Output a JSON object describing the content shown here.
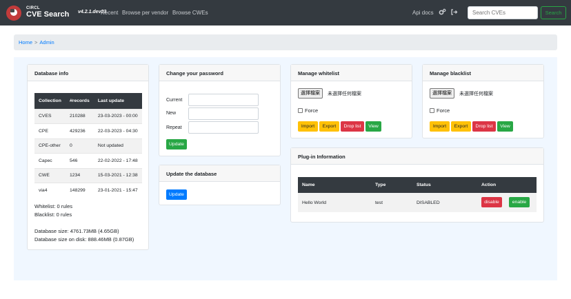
{
  "navbar": {
    "brand_small": "CIRCL",
    "brand_name": "CVE Search",
    "version": "v4.2.1.dev23",
    "links": [
      "Recent",
      "Browse per vendor",
      "Browse CWEs"
    ],
    "api_docs": "Api docs",
    "search_placeholder": "Search CVEs",
    "search_button": "Search"
  },
  "breadcrumb": {
    "home": "Home",
    "separator": ">",
    "current": "Admin"
  },
  "database_info": {
    "title": "Database info",
    "columns": [
      "Collection",
      "#records",
      "Last update"
    ],
    "rows": [
      [
        "CVES",
        "210288",
        "23-03-2023 - 00:00"
      ],
      [
        "CPE",
        "429236",
        "22-03-2023 - 04:30"
      ],
      [
        "CPE-other",
        "0",
        "Not updated"
      ],
      [
        "Capec",
        "546",
        "22-02-2022 - 17:48"
      ],
      [
        "CWE",
        "1234",
        "15-03-2021 - 12:38"
      ],
      [
        "via4",
        "148299",
        "23-01-2021 - 15:47"
      ]
    ],
    "whitelist": "Whitelist: 0 rules",
    "blacklist": "Blacklist: 0 rules",
    "db_size": "Database size: 4761.73MB (4.65GB)",
    "db_size_disk": "Database size on disk: 888.46MB (0.87GB)"
  },
  "password": {
    "title": "Change your password",
    "labels": [
      "Current",
      "New",
      "Repeat"
    ],
    "update": "Update"
  },
  "update_db": {
    "title": "Update the database",
    "update": "Update"
  },
  "whitelist": {
    "title": "Manage whitelist",
    "file_button": "選擇檔案",
    "file_text": "未選擇任何檔案",
    "force": "Force",
    "buttons": [
      "Import",
      "Export",
      "Drop list",
      "View"
    ]
  },
  "blacklist": {
    "title": "Manage blacklist",
    "file_button": "選擇檔案",
    "file_text": "未選擇任何檔案",
    "force": "Force",
    "buttons": [
      "Import",
      "Export",
      "Drop list",
      "View"
    ]
  },
  "plugins": {
    "title": "Plug-in Information",
    "columns": [
      "Name",
      "Type",
      "Status",
      "Action"
    ],
    "rows": [
      {
        "name": "Hello World",
        "type": "test",
        "status": "DISABLED",
        "disable": "disable",
        "enable": "enable"
      }
    ]
  },
  "colors": {
    "navbar": "#343a40",
    "success": "#28a745",
    "danger": "#dc3545",
    "warning": "#ffc107",
    "primary": "#007bff"
  },
  "icons": [
    "gears-icon",
    "sign-out-icon"
  ]
}
